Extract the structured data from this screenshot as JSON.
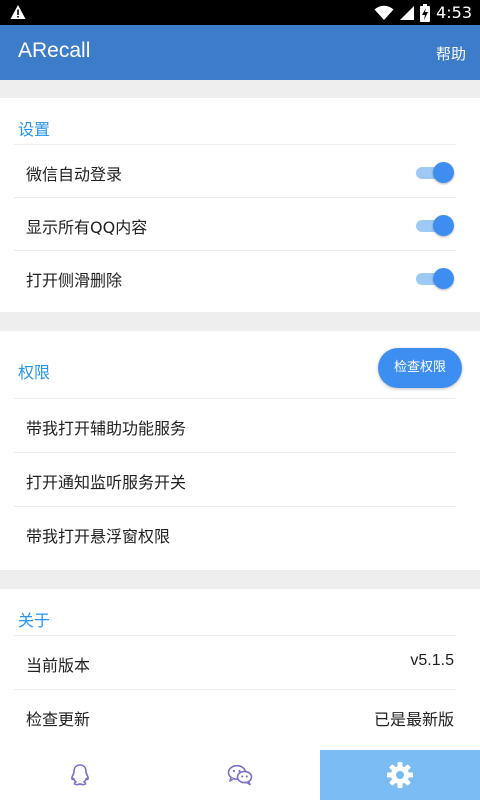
{
  "status": {
    "time": "4:53"
  },
  "appbar": {
    "title": "ARecall",
    "help": "帮助"
  },
  "settings": {
    "title": "设置",
    "items": [
      {
        "label": "微信自动登录",
        "on": true
      },
      {
        "label": "显示所有QQ内容",
        "on": true
      },
      {
        "label": "打开侧滑删除",
        "on": true
      }
    ]
  },
  "permissions": {
    "title": "权限",
    "check_button": "检查权限",
    "items": [
      {
        "label": "带我打开辅助功能服务"
      },
      {
        "label": "打开通知监听服务开关"
      },
      {
        "label": "带我打开悬浮窗权限"
      }
    ]
  },
  "about": {
    "title": "关于",
    "items": [
      {
        "label": "当前版本",
        "value": "v5.1.5"
      },
      {
        "label": "检查更新",
        "value": "已是最新版"
      }
    ]
  },
  "bottom_nav": {
    "items": [
      {
        "icon": "qq-icon",
        "active": false
      },
      {
        "icon": "wechat-icon",
        "active": false
      },
      {
        "icon": "gear-icon",
        "active": true
      }
    ]
  },
  "colors": {
    "appbar": "#3d7cc8",
    "accent": "#2196f3",
    "switch_thumb": "#3d8ef0",
    "active_tab": "#7cbcf5"
  }
}
